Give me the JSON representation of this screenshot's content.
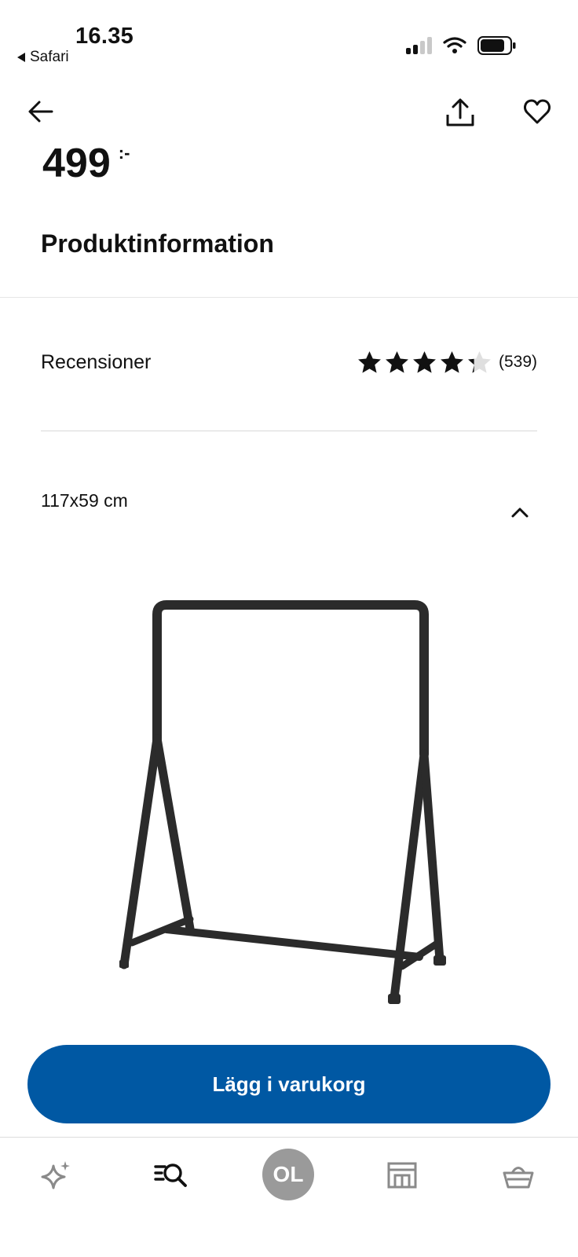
{
  "status_bar": {
    "time": "16.35",
    "back_app": "Safari"
  },
  "icons": {
    "back": "arrow-left-icon",
    "share": "share-icon",
    "favorite": "heart-icon",
    "collapse": "chevron-up-icon"
  },
  "product": {
    "price": "499",
    "price_suffix": ":-",
    "section_title": "Produktinformation",
    "reviews_label": "Recensioner",
    "rating": 4.3,
    "rating_max": 5,
    "review_count": "(539)",
    "size_label": "117x59 cm"
  },
  "cta": {
    "add_to_cart": "Lägg i varukorg"
  },
  "bottom_nav": {
    "items": [
      "sparkle-icon",
      "search-list-icon",
      "account-avatar",
      "store-icon",
      "basket-icon"
    ],
    "avatar_initials": "OL"
  },
  "colors": {
    "primary": "#0058a3",
    "text": "#111111",
    "star_filled": "#111111",
    "star_empty": "#dfdfdf",
    "nav_icon": "#8a8a8a",
    "avatar_bg": "#9a9a9a"
  }
}
